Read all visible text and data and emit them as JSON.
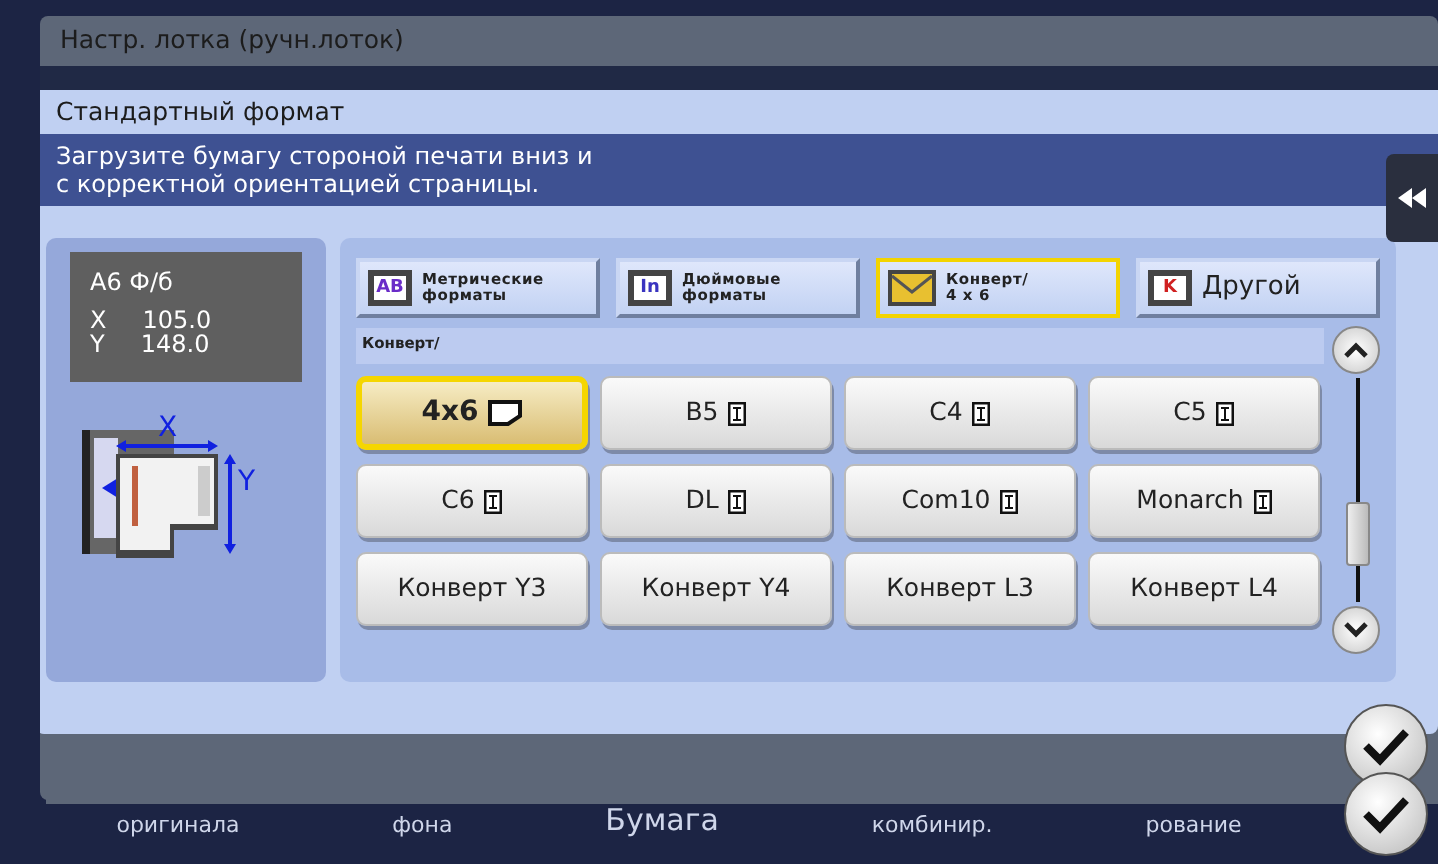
{
  "dialog": {
    "title": "Настр. лотка (ручн.лоток)"
  },
  "panel": {
    "title": "Стандартный формат",
    "message": "Загрузите бумагу стороной печати вниз и\nс корректной ориентацией страницы."
  },
  "info": {
    "format": "A6 Ф/б",
    "rows": [
      {
        "axis": "X",
        "value": "105.0"
      },
      {
        "axis": "Y",
        "value": "148.0"
      }
    ]
  },
  "diagram": {
    "x_label": "X",
    "y_label": "Y"
  },
  "tabs": [
    {
      "kind": "metric",
      "badge": "AB",
      "label": "Метрические\nформаты",
      "selected": false
    },
    {
      "kind": "inch",
      "badge": "In",
      "label": "Дюймовые\nформаты",
      "selected": false
    },
    {
      "kind": "envelope",
      "label": "Конверт/\n4 x 6",
      "selected": true
    },
    {
      "kind": "other",
      "badge": "K",
      "label": "Другой",
      "selected": false
    }
  ],
  "breadcrumb": "Конверт/",
  "sizes": [
    {
      "label": "4x6",
      "kind": "landscape",
      "selected": true
    },
    {
      "label": "B5",
      "kind": "portrait",
      "selected": false
    },
    {
      "label": "C4",
      "kind": "portrait",
      "selected": false
    },
    {
      "label": "C5",
      "kind": "portrait",
      "selected": false
    },
    {
      "label": "C6",
      "kind": "portrait",
      "selected": false
    },
    {
      "label": "DL",
      "kind": "portrait",
      "selected": false
    },
    {
      "label": "Com10",
      "kind": "portrait",
      "selected": false
    },
    {
      "label": "Monarch",
      "kind": "portrait",
      "selected": false
    },
    {
      "label": "Конверт Y3",
      "kind": "plain",
      "selected": false
    },
    {
      "label": "Конверт Y4",
      "kind": "plain",
      "selected": false
    },
    {
      "label": "Конверт L3",
      "kind": "plain",
      "selected": false
    },
    {
      "label": "Конверт L4",
      "kind": "plain",
      "selected": false
    }
  ],
  "bottom_tabs": [
    "оригинала",
    "фона",
    "Бумага",
    "комбинир.",
    "рование"
  ]
}
